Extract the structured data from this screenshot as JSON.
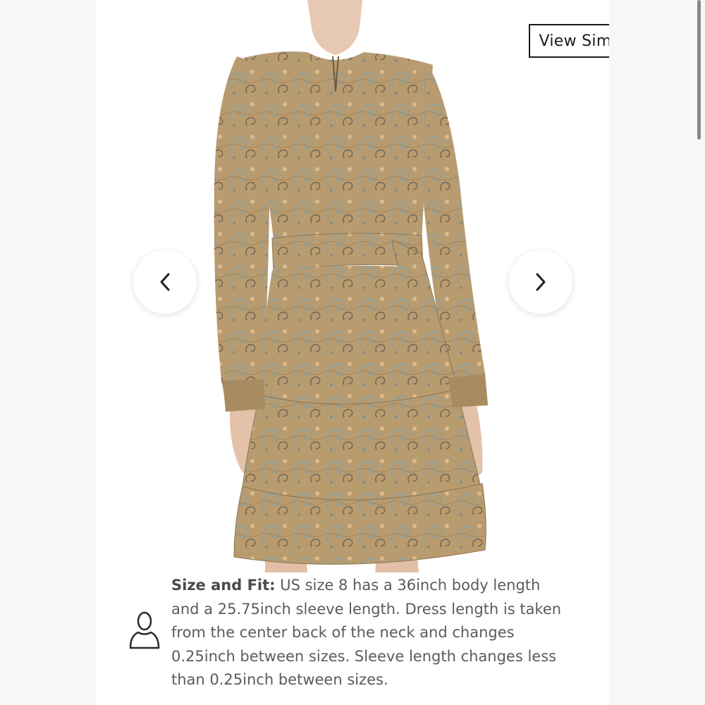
{
  "actions": {
    "view_similar_label": "View Similar"
  },
  "gallery": {
    "prev_icon": "chevron-left-icon",
    "next_icon": "chevron-right-icon",
    "image_subject": "paisley-print-tiered-dress"
  },
  "size_fit": {
    "label": "Size and Fit:",
    "text": " US size 8 has a 36inch body length and a 25.75inch sleeve length. Dress length is taken from the center back of the neck and changes 0.25inch between sizes. Sleeve length changes less than 0.25inch between sizes.",
    "icon": "person-icon"
  },
  "colors": {
    "text": "#5b5b5b",
    "border": "#1a1a1a",
    "dress_base": "#b89a6e",
    "dress_accent": "#8fa3a0"
  }
}
